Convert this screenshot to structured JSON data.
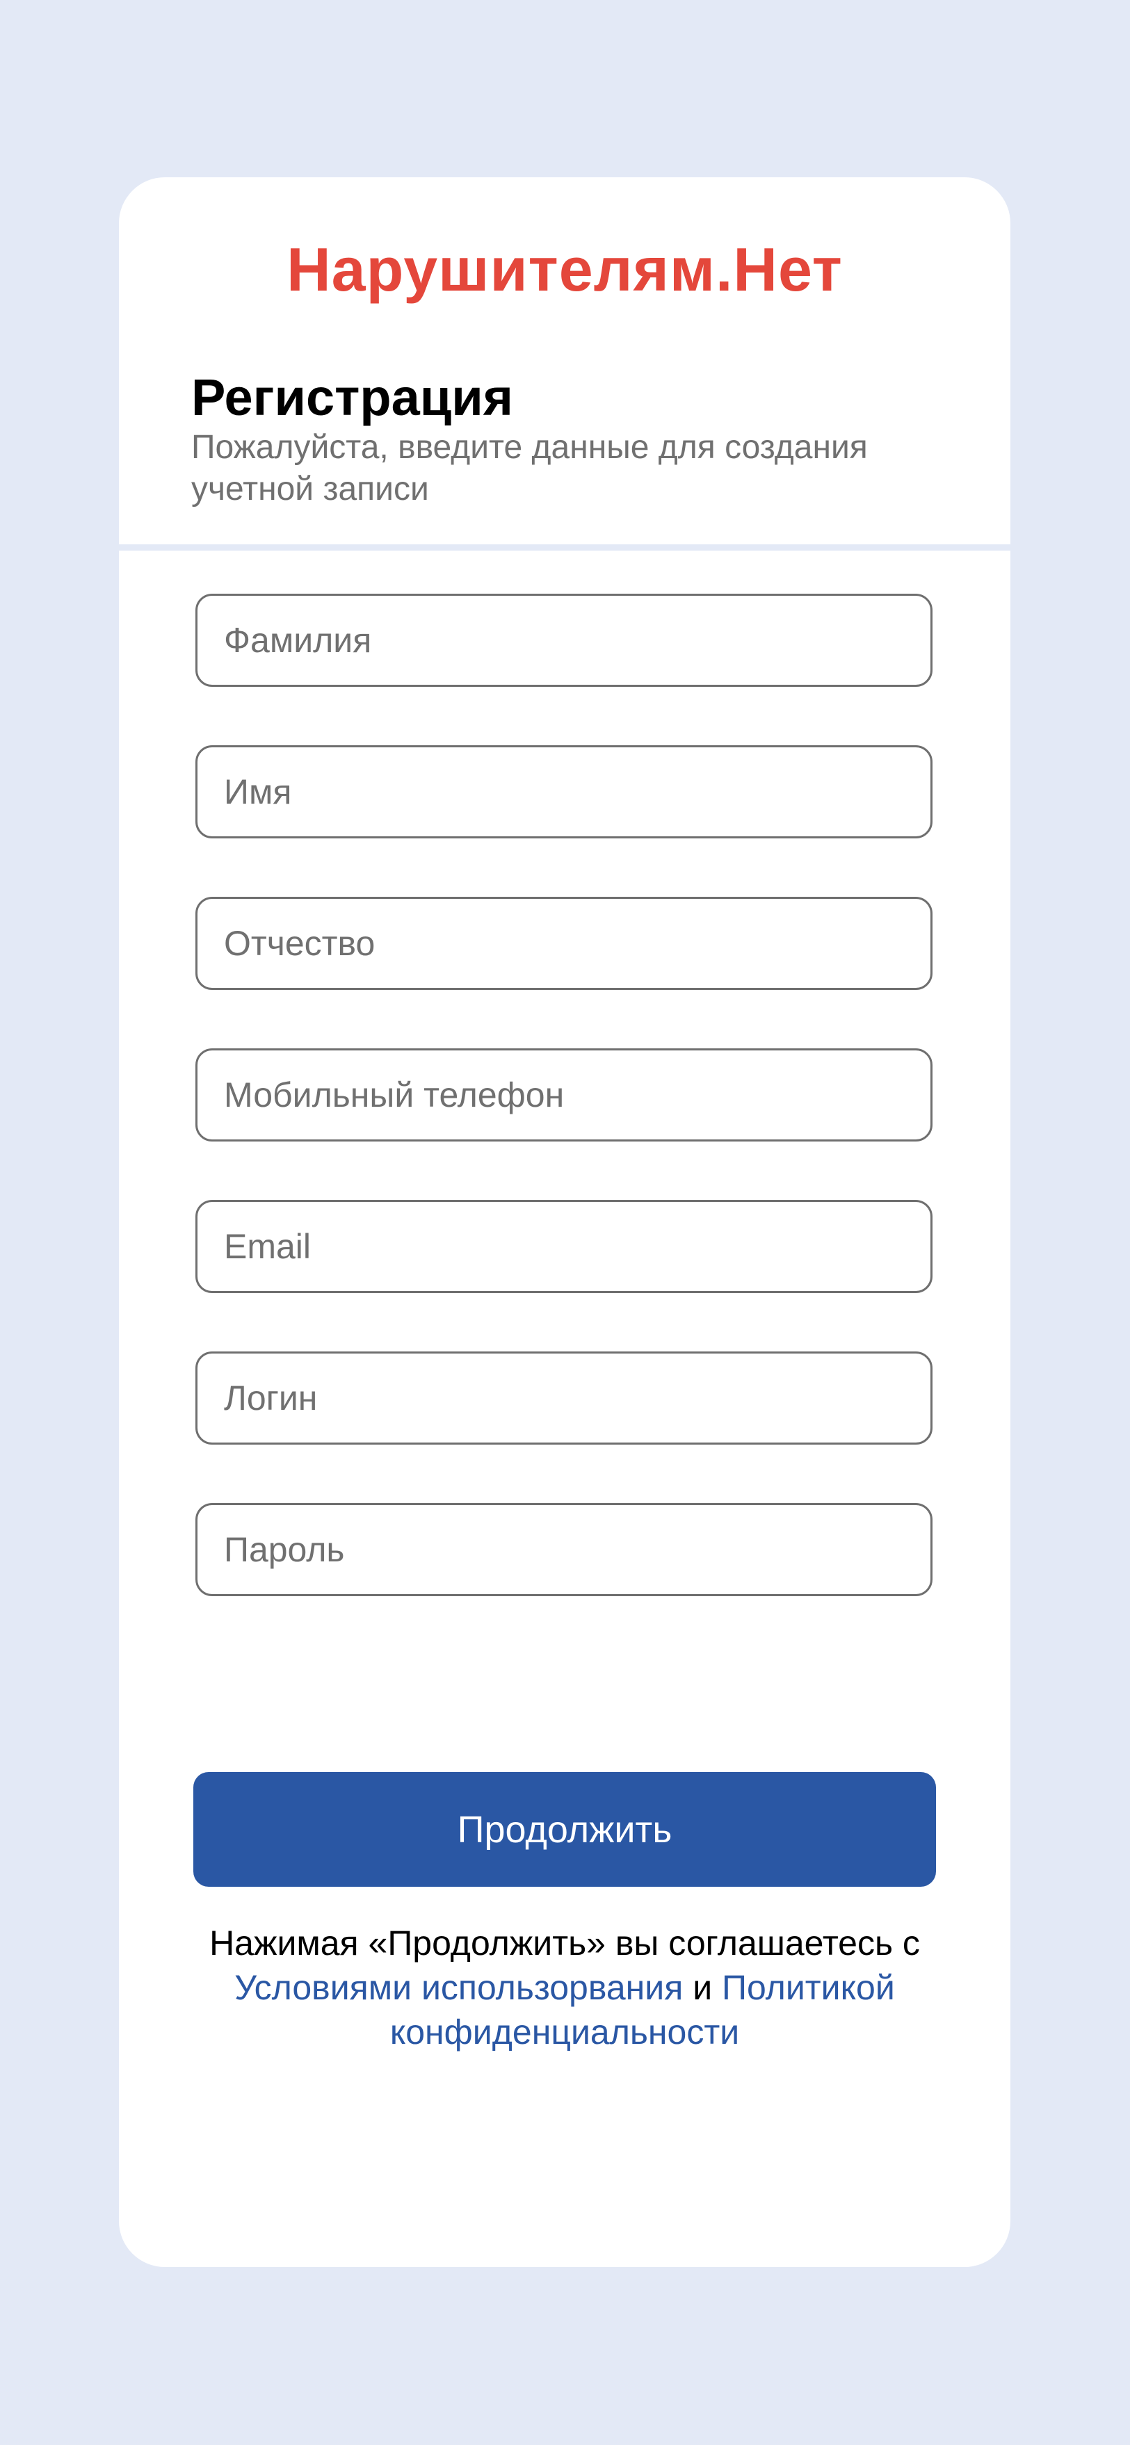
{
  "brand": {
    "name": "Нарушителям.Нет",
    "color": "#e4473b"
  },
  "registration": {
    "title": "Регистрация",
    "subtitle": "Пожалуйста, введите данные для создания учетной записи"
  },
  "form": {
    "fields": [
      {
        "placeholder": "Фамилия",
        "value": ""
      },
      {
        "placeholder": "Имя",
        "value": ""
      },
      {
        "placeholder": "Отчество",
        "value": ""
      },
      {
        "placeholder": "Мобильный телефон",
        "value": ""
      },
      {
        "placeholder": "Email",
        "value": ""
      },
      {
        "placeholder": "Логин",
        "value": ""
      },
      {
        "placeholder": "Пароль",
        "value": ""
      }
    ],
    "continue_label": "Продолжить",
    "accent_color": "#2a57a4"
  },
  "consent": {
    "text_before": "Нажимая «Продолжить» вы соглашаетесь с ",
    "terms_link": "Условиями использорвания",
    "conjunction": " и ",
    "privacy_link": "Политикой конфиденциальности"
  }
}
